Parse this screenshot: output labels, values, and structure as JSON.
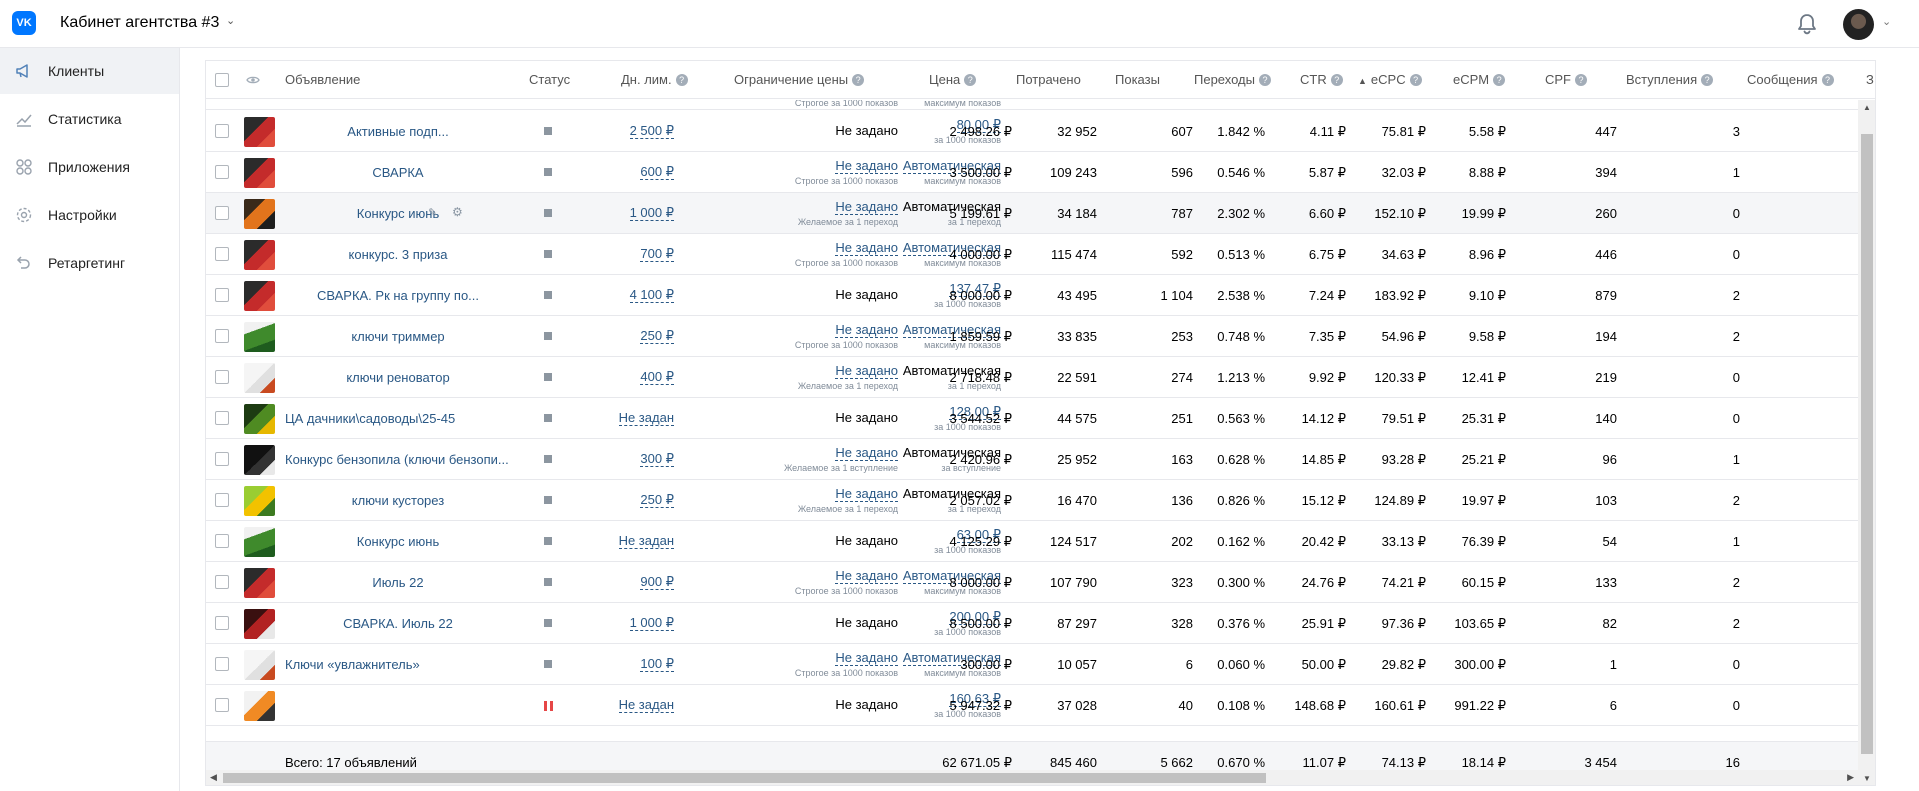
{
  "topbar": {
    "logo": "VK",
    "cabinet_title": "Кабинет агентства #3",
    "chevron": "⌄"
  },
  "sidebar": {
    "items": [
      {
        "label": "Клиенты",
        "icon": "megaphone-icon",
        "active": true
      },
      {
        "label": "Статистика",
        "icon": "chart-icon",
        "active": false
      },
      {
        "label": "Приложения",
        "icon": "apps-icon",
        "active": false
      },
      {
        "label": "Настройки",
        "icon": "gear-icon",
        "active": false
      },
      {
        "label": "Ретаргетинг",
        "icon": "retarget-icon",
        "active": false
      }
    ]
  },
  "table": {
    "headers": {
      "ad": "Объявление",
      "status": "Статус",
      "daily_limit": "Дн. лим.",
      "price_limit": "Ограничение цены",
      "price": "Цена",
      "spent": "Потрачено",
      "impressions": "Показы",
      "clicks": "Переходы",
      "ctr": "CTR",
      "ecpc": "eCPC",
      "ecpm": "eCPM",
      "cpf": "CPF",
      "joins": "Вступления",
      "messages": "Сообщения",
      "next": "З"
    },
    "sort_column": "ecpc",
    "partial_row": {
      "price_limit_sub": "Строгое за 1000 показов",
      "price_sub": "максимум показов"
    },
    "rows": [
      {
        "name": "Активные подп...",
        "name_align": "center",
        "thumb": "red",
        "status": "active",
        "daily_limit": "2 500 ₽",
        "limit": "Не задано",
        "limit_link": false,
        "limit_sub": "",
        "price": "80.00 ₽",
        "price_link": true,
        "price_sub": "за 1000 показов",
        "spent": "2 498.26 ₽",
        "impressions": "32 952",
        "clicks": "607",
        "ctr": "1.842 %",
        "ecpc": "4.11 ₽",
        "ecpm": "75.81 ₽",
        "cpf": "5.58 ₽",
        "joins": "447",
        "messages": "3"
      },
      {
        "name": "СВАРКА",
        "name_align": "center",
        "thumb": "red",
        "status": "active",
        "daily_limit": "600 ₽",
        "limit": "Не задано",
        "limit_link": true,
        "limit_sub": "Строгое за 1000 показов",
        "price": "Автоматическая",
        "price_link": true,
        "price_sub": "максимум показов",
        "spent": "3 500.00 ₽",
        "impressions": "109 243",
        "clicks": "596",
        "ctr": "0.546 %",
        "ecpc": "5.87 ₽",
        "ecpm": "32.03 ₽",
        "cpf": "8.88 ₽",
        "joins": "394",
        "messages": "1"
      },
      {
        "name": "Конкурс июнь",
        "name_align": "center",
        "thumb": "orange",
        "status": "active",
        "hover": true,
        "daily_limit": "1 000 ₽",
        "limit": "Не задано",
        "limit_link": true,
        "limit_sub": "Желаемое за 1 переход",
        "price": "Автоматическая",
        "price_link": false,
        "price_sub": "за 1 переход",
        "spent": "5 199.61 ₽",
        "impressions": "34 184",
        "clicks": "787",
        "ctr": "2.302 %",
        "ecpc": "6.60 ₽",
        "ecpm": "152.10 ₽",
        "cpf": "19.99 ₽",
        "joins": "260",
        "messages": "0"
      },
      {
        "name": "конкурс. 3 приза",
        "name_align": "center",
        "thumb": "red",
        "status": "active",
        "daily_limit": "700 ₽",
        "limit": "Не задано",
        "limit_link": true,
        "limit_sub": "Строгое за 1000 показов",
        "price": "Автоматическая",
        "price_link": true,
        "price_sub": "максимум показов",
        "spent": "4 000.00 ₽",
        "impressions": "115 474",
        "clicks": "592",
        "ctr": "0.513 %",
        "ecpc": "6.75 ₽",
        "ecpm": "34.63 ₽",
        "cpf": "8.96 ₽",
        "joins": "446",
        "messages": "0"
      },
      {
        "name": "СВАРКА. Рк на группу по...",
        "name_align": "center",
        "thumb": "red",
        "status": "active",
        "daily_limit": "4 100 ₽",
        "limit": "Не задано",
        "limit_link": false,
        "limit_sub": "",
        "price": "137.47 ₽",
        "price_link": true,
        "price_sub": "за 1000 показов",
        "spent": "8 000.00 ₽",
        "impressions": "43 495",
        "clicks": "1 104",
        "ctr": "2.538 %",
        "ecpc": "7.24 ₽",
        "ecpm": "183.92 ₽",
        "cpf": "9.10 ₽",
        "joins": "879",
        "messages": "2"
      },
      {
        "name": "ключи триммер",
        "name_align": "center",
        "thumb": "green",
        "status": "active",
        "daily_limit": "250 ₽",
        "limit": "Не задано",
        "limit_link": true,
        "limit_sub": "Строгое за 1000 показов",
        "price": "Автоматическая",
        "price_link": true,
        "price_sub": "максимум показов",
        "spent": "1 859.59 ₽",
        "impressions": "33 835",
        "clicks": "253",
        "ctr": "0.748 %",
        "ecpc": "7.35 ₽",
        "ecpm": "54.96 ₽",
        "cpf": "9.58 ₽",
        "joins": "194",
        "messages": "2"
      },
      {
        "name": "ключи реноватор",
        "name_align": "center",
        "thumb": "white",
        "status": "active",
        "daily_limit": "400 ₽",
        "limit": "Не задано",
        "limit_link": true,
        "limit_sub": "Желаемое за 1 переход",
        "price": "Автоматическая",
        "price_link": false,
        "price_sub": "за 1 переход",
        "spent": "2 718.48 ₽",
        "impressions": "22 591",
        "clicks": "274",
        "ctr": "1.213 %",
        "ecpc": "9.92 ₽",
        "ecpm": "120.33 ₽",
        "cpf": "12.41 ₽",
        "joins": "219",
        "messages": "0"
      },
      {
        "name": "ЦА дачники\\садоводы\\25-45",
        "name_align": "left",
        "thumb": "darkgreen",
        "status": "active",
        "daily_limit": "Не задан",
        "limit": "Не задано",
        "limit_link": false,
        "limit_sub": "",
        "price": "128.00 ₽",
        "price_link": true,
        "price_sub": "за 1000 показов",
        "spent": "3 544.52 ₽",
        "impressions": "44 575",
        "clicks": "251",
        "ctr": "0.563 %",
        "ecpc": "14.12 ₽",
        "ecpm": "79.51 ₽",
        "cpf": "25.31 ₽",
        "joins": "140",
        "messages": "0"
      },
      {
        "name": "Конкурс бензопила (ключи бензопи...",
        "name_align": "left",
        "thumb": "dark",
        "status": "active",
        "daily_limit": "300 ₽",
        "limit": "Не задано",
        "limit_link": true,
        "limit_sub": "Желаемое за 1 вступление",
        "price": "Автоматическая",
        "price_link": false,
        "price_sub": "за вступление",
        "spent": "2 420.96 ₽",
        "impressions": "25 952",
        "clicks": "163",
        "ctr": "0.628 %",
        "ecpc": "14.85 ₽",
        "ecpm": "93.28 ₽",
        "cpf": "25.21 ₽",
        "joins": "96",
        "messages": "1"
      },
      {
        "name": "ключи кусторез",
        "name_align": "center",
        "thumb": "yellowgreen",
        "status": "active",
        "daily_limit": "250 ₽",
        "limit": "Не задано",
        "limit_link": true,
        "limit_sub": "Желаемое за 1 переход",
        "price": "Автоматическая",
        "price_link": false,
        "price_sub": "за 1 переход",
        "spent": "2 057.02 ₽",
        "impressions": "16 470",
        "clicks": "136",
        "ctr": "0.826 %",
        "ecpc": "15.12 ₽",
        "ecpm": "124.89 ₽",
        "cpf": "19.97 ₽",
        "joins": "103",
        "messages": "2"
      },
      {
        "name": "Конкурс июнь",
        "name_align": "center",
        "thumb": "green",
        "status": "active",
        "daily_limit": "Не задан",
        "limit": "Не задано",
        "limit_link": false,
        "limit_sub": "",
        "price": "63.00 ₽",
        "price_link": true,
        "price_sub": "за 1000 показов",
        "spent": "4 125.29 ₽",
        "impressions": "124 517",
        "clicks": "202",
        "ctr": "0.162 %",
        "ecpc": "20.42 ₽",
        "ecpm": "33.13 ₽",
        "cpf": "76.39 ₽",
        "joins": "54",
        "messages": "1"
      },
      {
        "name": "Июль 22",
        "name_align": "center",
        "thumb": "red",
        "status": "active",
        "daily_limit": "900 ₽",
        "limit": "Не задано",
        "limit_link": true,
        "limit_sub": "Строгое за 1000 показов",
        "price": "Автоматическая",
        "price_link": true,
        "price_sub": "максимум показов",
        "spent": "8 000.00 ₽",
        "impressions": "107 790",
        "clicks": "323",
        "ctr": "0.300 %",
        "ecpc": "24.76 ₽",
        "ecpm": "74.21 ₽",
        "cpf": "60.15 ₽",
        "joins": "133",
        "messages": "2"
      },
      {
        "name": "СВАРКА. Июль 22",
        "name_align": "center",
        "thumb": "darkred",
        "status": "active",
        "daily_limit": "1 000 ₽",
        "limit": "Не задано",
        "limit_link": false,
        "limit_sub": "",
        "price": "200.00 ₽",
        "price_link": true,
        "price_sub": "за 1000 показов",
        "spent": "8 500.00 ₽",
        "impressions": "87 297",
        "clicks": "328",
        "ctr": "0.376 %",
        "ecpc": "25.91 ₽",
        "ecpm": "97.36 ₽",
        "cpf": "103.65 ₽",
        "joins": "82",
        "messages": "2"
      },
      {
        "name": "Ключи «увлажнитель»",
        "name_align": "left",
        "thumb": "white",
        "status": "active",
        "daily_limit": "100 ₽",
        "limit": "Не задано",
        "limit_link": true,
        "limit_sub": "Строгое за 1000 показов",
        "price": "Автоматическая",
        "price_link": true,
        "price_sub": "максимум показов",
        "spent": "300.00 ₽",
        "impressions": "10 057",
        "clicks": "6",
        "ctr": "0.060 %",
        "ecpc": "50.00 ₽",
        "ecpm": "29.82 ₽",
        "cpf": "300.00 ₽",
        "joins": "1",
        "messages": "0"
      },
      {
        "name": "",
        "name_align": "left",
        "thumb": "orangewhite",
        "status": "paused",
        "daily_limit": "Не задан",
        "limit": "Не задано",
        "limit_link": false,
        "limit_sub": "",
        "price": "160.63 ₽",
        "price_link": true,
        "price_sub": "за 1000 показов",
        "spent": "5 947.32 ₽",
        "impressions": "37 028",
        "clicks": "40",
        "ctr": "0.108 %",
        "ecpc": "148.68 ₽",
        "ecpm": "160.61 ₽",
        "cpf": "991.22 ₽",
        "joins": "6",
        "messages": "0"
      }
    ],
    "totals": {
      "label": "Всего: 17 объявлений",
      "spent": "62 671.05 ₽",
      "impressions": "845 460",
      "clicks": "5 662",
      "ctr": "0.670 %",
      "ecpc": "11.07 ₽",
      "ecpm": "74.13 ₽",
      "cpf": "18.14 ₽",
      "joins": "3 454",
      "messages": "16"
    }
  },
  "colors": {
    "accent": "#2a5885",
    "vk_blue": "#0077ff",
    "paused_red": "#e64646"
  }
}
